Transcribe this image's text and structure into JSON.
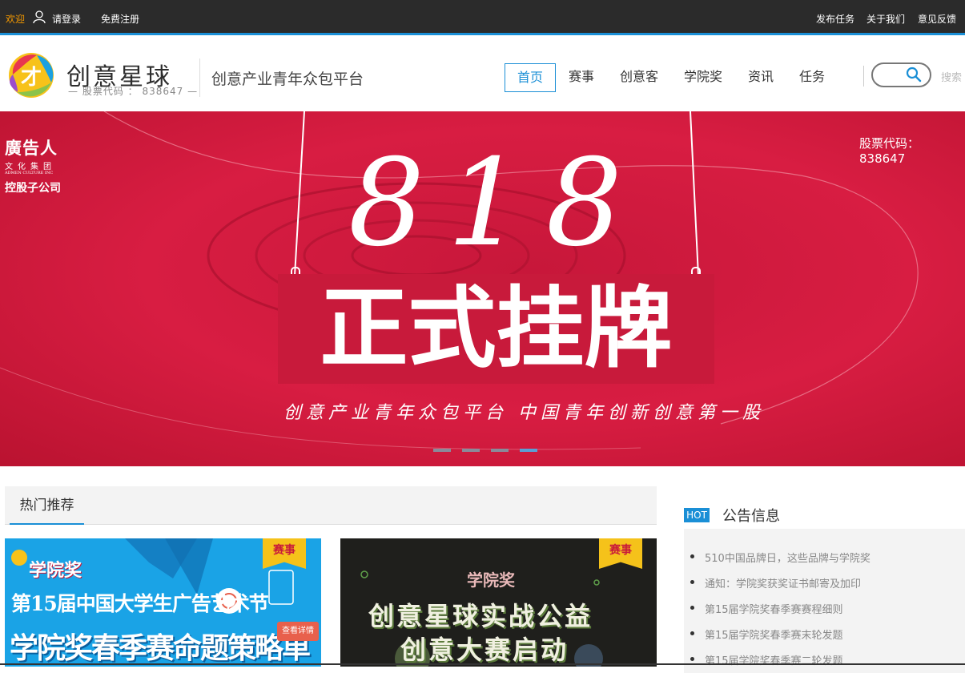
{
  "topbar": {
    "welcome": "欢迎",
    "login": "请登录",
    "register": "免费注册",
    "links": [
      "发布任务",
      "关于我们",
      "意见反馈"
    ]
  },
  "header": {
    "logo_title": "创意星球",
    "logo_sub": "— 股票代码 ： 838647 —",
    "slogan": "创意产业青年众包平台",
    "nav": [
      "首页",
      "赛事",
      "创意客",
      "学院奖",
      "资讯",
      "任务"
    ],
    "active_nav": "首页",
    "search_label": "搜索"
  },
  "banner": {
    "group_name": "廣告人",
    "group_sub": "文化集团",
    "group_en": "ADMEN CULTURE INC",
    "group_role": "控股子公司",
    "stock": "股票代码：838647",
    "headline_number": "818",
    "headline_text": "正式挂牌",
    "calligraphy": "创意产业青年众包平台   中国青年创新创意第一股",
    "slides": 4,
    "active_slide": 4
  },
  "hot": {
    "tab": "热门推荐",
    "cards": [
      {
        "tag": "赛事",
        "brand": "学院奖",
        "title": "第15届中国大学生广告艺术节",
        "headline": "学院奖春季赛命题策略单",
        "button": "查看详情"
      },
      {
        "tag": "赛事",
        "brand": "学院奖",
        "line1": "创意星球实战公益",
        "line2": "创意大赛启动"
      }
    ]
  },
  "notice": {
    "badge": "HOT",
    "title": "公告信息",
    "items": [
      "510中国品牌日，这些品牌与学院奖",
      "通知：学院奖获奖证书邮寄及加印",
      "第15届学院奖春季赛赛程细则",
      "第15届学院奖春季赛末轮发题",
      "第15届学院奖春季赛二轮发题"
    ]
  },
  "colors": {
    "accent": "#1a8fd6",
    "welcome": "#f39800",
    "banner": "#d0193c",
    "topbar": "#2b2b2b"
  }
}
